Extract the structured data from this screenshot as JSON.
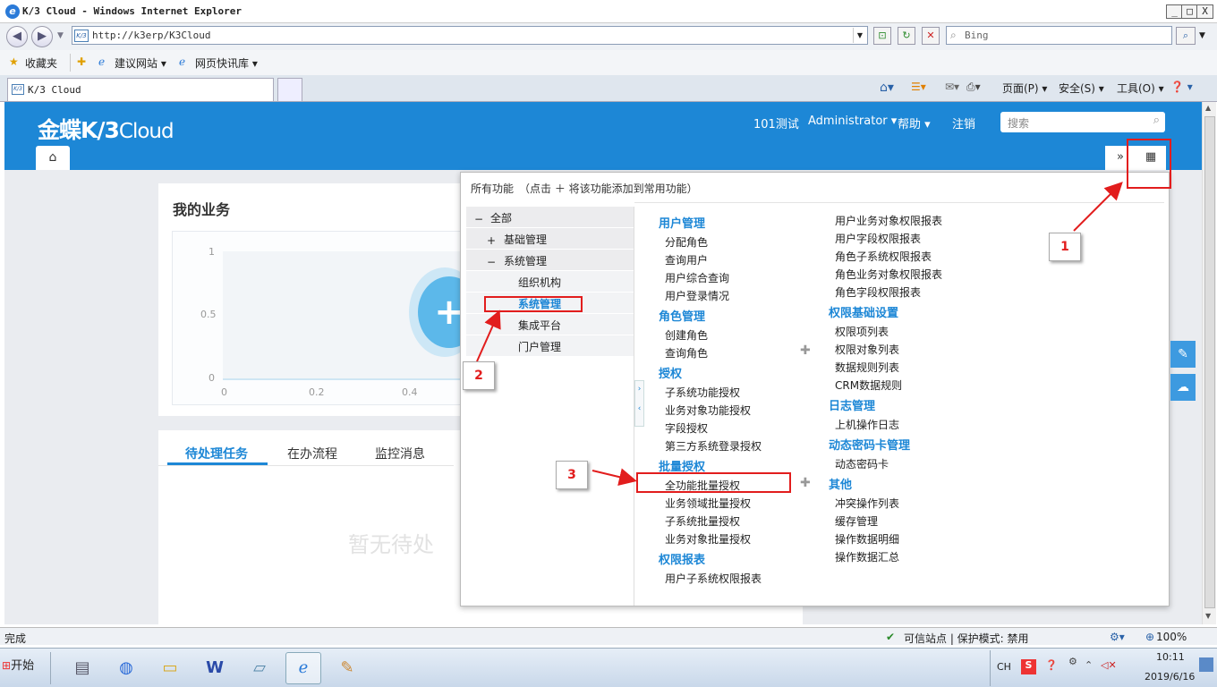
{
  "window": {
    "title": "K/3 Cloud - Windows Internet Explorer",
    "min": "_",
    "max": "□",
    "close": "X"
  },
  "nav": {
    "url": "http://k3erp/K3Cloud",
    "search_placeholder": "Bing"
  },
  "favbar": {
    "favorites": "收藏夹",
    "suggested": "建议网站 ▾",
    "webslices": "网页快讯库 ▾"
  },
  "tab": {
    "title": "K/3 Cloud"
  },
  "ie_cmd": {
    "page": "页面(P) ▾",
    "safety": "安全(S) ▾",
    "tools": "工具(O) ▾",
    "help": "❓ ▾"
  },
  "app": {
    "logo_main": "金蝶K/3",
    "logo_sub": "Cloud",
    "org": "101测试",
    "user": "Administrator ▾",
    "help": "帮助 ▾",
    "logout": "注销",
    "search_placeholder": "搜索"
  },
  "my_business": {
    "title": "我的业务",
    "yticks": [
      "1",
      "0.5",
      "0"
    ],
    "xticks": [
      "0",
      "0.2",
      "0.4"
    ]
  },
  "tasks": {
    "tabs": [
      "待处理任务",
      "在办流程",
      "监控消息"
    ],
    "empty": "暂无待处"
  },
  "panel": {
    "header": "所有功能　（点击 ＋ 将该功能添加到常用功能）",
    "tree": {
      "all": "全部",
      "basic": "基础管理",
      "system": "系统管理",
      "children": [
        "组织机构",
        "系统管理",
        "集成平台",
        "门户管理"
      ]
    },
    "col1": {
      "user_mgmt": {
        "title": "用户管理",
        "items": [
          "分配角色",
          "查询用户",
          "用户综合查询",
          "用户登录情况"
        ]
      },
      "role_mgmt": {
        "title": "角色管理",
        "items": [
          "创建角色",
          "查询角色"
        ]
      },
      "auth": {
        "title": "授权",
        "items": [
          "子系统功能授权",
          "业务对象功能授权",
          "字段授权",
          "第三方系统登录授权"
        ]
      },
      "batch": {
        "title": "批量授权",
        "items": [
          "全功能批量授权",
          "业务领域批量授权",
          "子系统批量授权",
          "业务对象批量授权"
        ]
      },
      "report": {
        "title": "权限报表",
        "items": [
          "用户子系统权限报表"
        ]
      }
    },
    "col2": {
      "report_cont": {
        "items": [
          "用户业务对象权限报表",
          "用户字段权限报表",
          "角色子系统权限报表",
          "角色业务对象权限报表",
          "角色字段权限报表"
        ]
      },
      "basic_set": {
        "title": "权限基础设置",
        "items": [
          "权限项列表",
          "权限对象列表",
          "数据规则列表",
          "CRM数据规则"
        ]
      },
      "log": {
        "title": "日志管理",
        "items": [
          "上机操作日志"
        ]
      },
      "dyncard": {
        "title": "动态密码卡管理",
        "items": [
          "动态密码卡"
        ]
      },
      "other": {
        "title": "其他",
        "items": [
          "冲突操作列表",
          "缓存管理",
          "操作数据明细",
          "操作数据汇总"
        ]
      }
    }
  },
  "annotations": [
    "1",
    "2",
    "3"
  ],
  "statusbar": {
    "left": "完成",
    "zone": "可信站点 | 保护模式: 禁用",
    "zoom": "100%"
  },
  "taskbar": {
    "start": "开始",
    "lang": "CH",
    "time": "10:11",
    "date": "2019/6/16"
  },
  "colors": {
    "brand": "#1d87d6",
    "annotation": "#e21d1d"
  }
}
